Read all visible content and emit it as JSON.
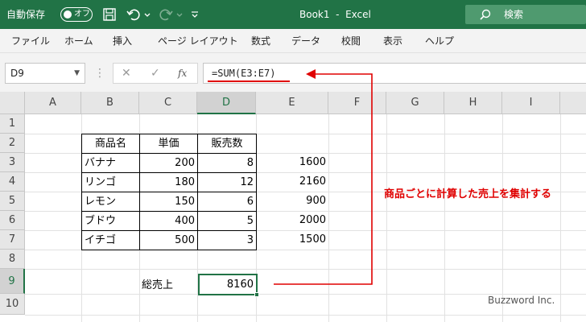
{
  "titlebar": {
    "autosave_label": "自動保存",
    "autosave_state": "オフ",
    "title": "Book1  -  Excel",
    "search_label": "検索"
  },
  "ribbon": {
    "tabs": [
      "ファイル",
      "ホーム",
      "挿入",
      "ページ レイアウト",
      "数式",
      "データ",
      "校閲",
      "表示",
      "ヘルプ"
    ]
  },
  "formula_bar": {
    "name_box": "D9",
    "fx": "fx",
    "formula": "=SUM(E3:E7)"
  },
  "sheet": {
    "columns": [
      "A",
      "B",
      "C",
      "D",
      "E",
      "F",
      "G",
      "H",
      "I"
    ],
    "rows": [
      "1",
      "2",
      "3",
      "4",
      "5",
      "6",
      "7",
      "8",
      "9",
      "10"
    ],
    "selected_column": "D",
    "selected_row": "9",
    "table": {
      "headers": [
        "商品名",
        "単価",
        "販売数"
      ],
      "rows": [
        {
          "name": "バナナ",
          "price": "200",
          "qty": "8",
          "total": "1600"
        },
        {
          "name": "リンゴ",
          "price": "180",
          "qty": "12",
          "total": "2160"
        },
        {
          "name": "レモン",
          "price": "150",
          "qty": "6",
          "total": "900"
        },
        {
          "name": "ブドウ",
          "price": "400",
          "qty": "5",
          "total": "2000"
        },
        {
          "name": "イチゴ",
          "price": "500",
          "qty": "3",
          "total": "1500"
        }
      ]
    },
    "total_label": "総売上",
    "total_value": "8160"
  },
  "annotation": "商品ごとに計算した売上を集計する",
  "watermark": "Buzzword Inc.",
  "colors": {
    "excel_green": "#217346",
    "annotation_red": "#e00000"
  }
}
